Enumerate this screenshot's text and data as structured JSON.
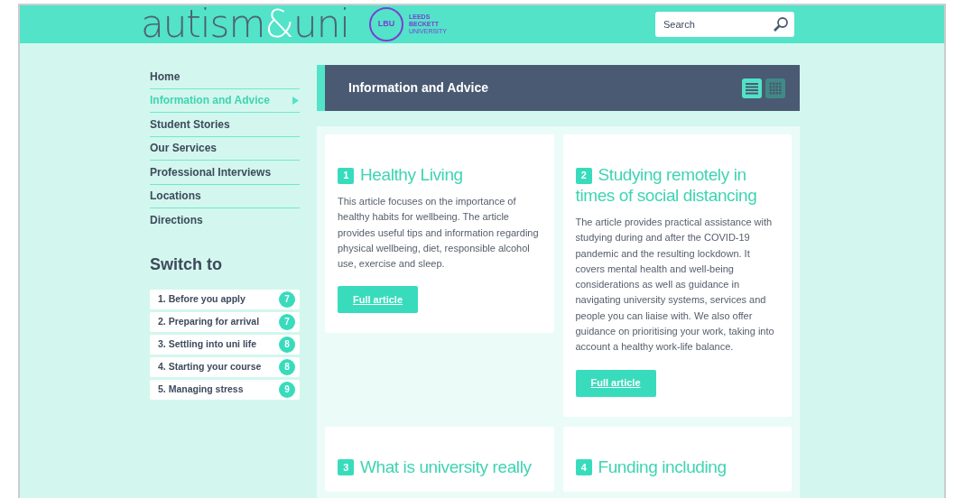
{
  "header": {
    "logo": [
      {
        "text": "autism",
        "kind": "main"
      },
      {
        "text": "&",
        "kind": "accent"
      },
      {
        "text": "uni",
        "kind": "main"
      }
    ],
    "emblem": "LBU",
    "university": [
      "LEEDS",
      "BECKETT",
      "UNIVERSITY"
    ],
    "search": {
      "placeholder": "Search"
    }
  },
  "nav": [
    {
      "label": "Home",
      "selected": false
    },
    {
      "label": "Information and Advice",
      "selected": true
    },
    {
      "label": "Student Stories",
      "selected": false
    },
    {
      "label": "Our Services",
      "selected": false
    },
    {
      "label": "Professional Interviews",
      "selected": false
    },
    {
      "label": "Locations",
      "selected": false
    },
    {
      "label": "Directions",
      "selected": false
    }
  ],
  "switch_to": {
    "title": "Switch to",
    "items": [
      {
        "label": "1. Before you apply",
        "count": "7"
      },
      {
        "label": "2. Preparing for arrival",
        "count": "7"
      },
      {
        "label": "3. Settling into uni life",
        "count": "8"
      },
      {
        "label": "4. Starting your course",
        "count": "8"
      },
      {
        "label": "5. Managing stress",
        "count": "9"
      }
    ]
  },
  "section": {
    "title": "Information and Advice",
    "views": [
      {
        "kind": "list",
        "selected": true
      },
      {
        "kind": "grid",
        "selected": false
      }
    ]
  },
  "articles": [
    {
      "number": "1",
      "title": "Healthy Living",
      "text": "This article focuses on the importance of healthy habits for wellbeing. The article provides useful tips and information regarding physical wellbeing, diet, responsible alcohol use, exercise and sleep.",
      "button": "Full article"
    },
    {
      "number": "2",
      "title": "Studying remotely in times of social distancing",
      "text": "The article provides practical assistance with studying during and after the COVID-19 pandemic and the resulting lockdown. It covers mental health and well-being considerations as well as guidance in navigating university systems, services and people you can liaise with. We also offer guidance on prioritising your work, taking into account a healthy work-life balance.",
      "button": "Full article"
    },
    {
      "number": "3",
      "title": "What is university really"
    },
    {
      "number": "4",
      "title": "Funding including"
    }
  ]
}
